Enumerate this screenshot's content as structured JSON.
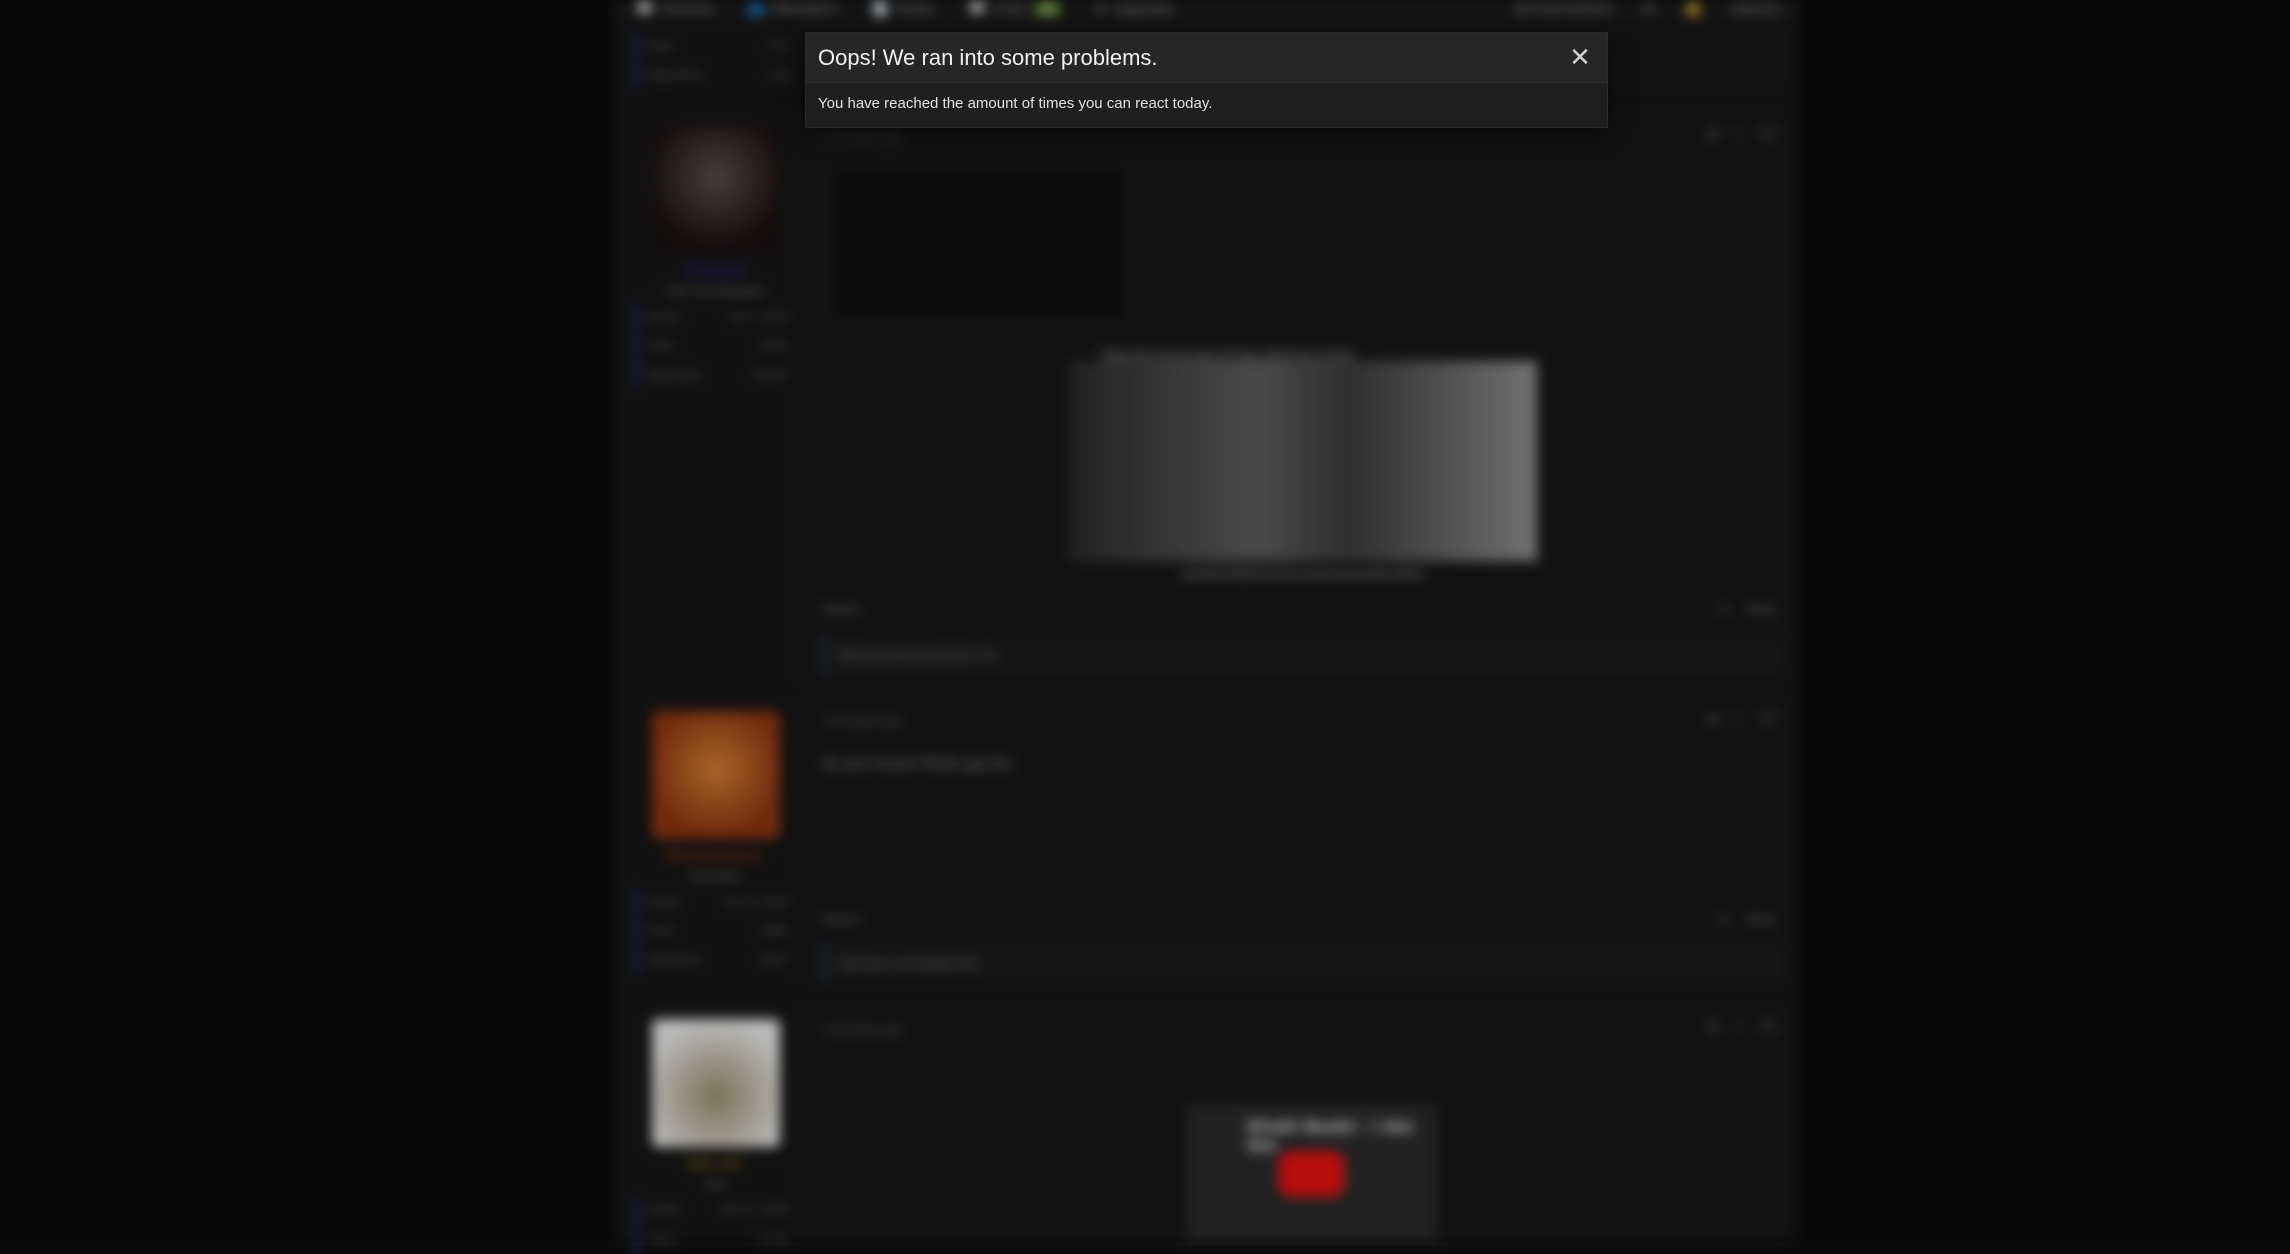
{
  "navbar": {
    "items": [
      "Forums",
      "Members",
      "Rules",
      "Chat",
      "Upgrade"
    ],
    "chat_badge": "24",
    "right_items": [
      "SomeoneHere",
      "Search"
    ]
  },
  "posts": [
    {
      "username": "Tsunnyoo",
      "title": "CXC Card Buzzard",
      "name_color": "#4a2fd0",
      "stats": [
        {
          "label": "Joined",
          "value": "Jan 5, 2026"
        },
        {
          "label": "Posts",
          "value": "8,023"
        },
        {
          "label": "Reputation",
          "value": "20,391"
        }
      ],
      "time": "4 minutes ago",
      "post_number": "#2",
      "caption_top": "Make My Forum User Of Year 2026 For A Treat",
      "caption_bottom": "All Posts Made By Tsun Cxm Are Sarcastic Satire",
      "report": "Report",
      "like": "+1",
      "reply": "Reply",
      "reactions": "Nitrosonerencz and Sub +CL"
    },
    {
      "username": "Nitrosonerencz",
      "title": "Summary",
      "name_color": "#c23a10",
      "stats": [
        {
          "label": "Joined",
          "value": "Jan 19, 2026"
        },
        {
          "label": "Posts",
          "value": "4,865"
        },
        {
          "label": "Reputation",
          "value": "6,567"
        }
      ],
      "time": "4 minutes ago",
      "post_number": "#3",
      "text": "At your house? Kledo gay lbs",
      "report": "Report",
      "like": "+1",
      "reply": "Reply",
      "reactions": "Tsunnyoo and Daddy Dot"
    },
    {
      "username": "Sub +CL",
      "title": "Sub",
      "name_color": "#c79a12",
      "stats": [
        {
          "label": "Joined",
          "value": "Mar 11, 2026"
        },
        {
          "label": "Posts",
          "value": "4,136"
        }
      ],
      "time": "4 minutes ago",
      "post_number": "#4",
      "video_title": "Khabi Baabi - I Am the"
    }
  ],
  "dialog": {
    "title": "Oops! We ran into some problems.",
    "message": "You have reached the amount of times you can react today.",
    "close_glyph": "✕"
  },
  "colors": {
    "background": "#0b0b0b",
    "forum_bg": "#141414",
    "dialog_bg": "#1f1f1f",
    "dialog_header_bg": "#262626",
    "accent_border": "#2c3b86"
  }
}
